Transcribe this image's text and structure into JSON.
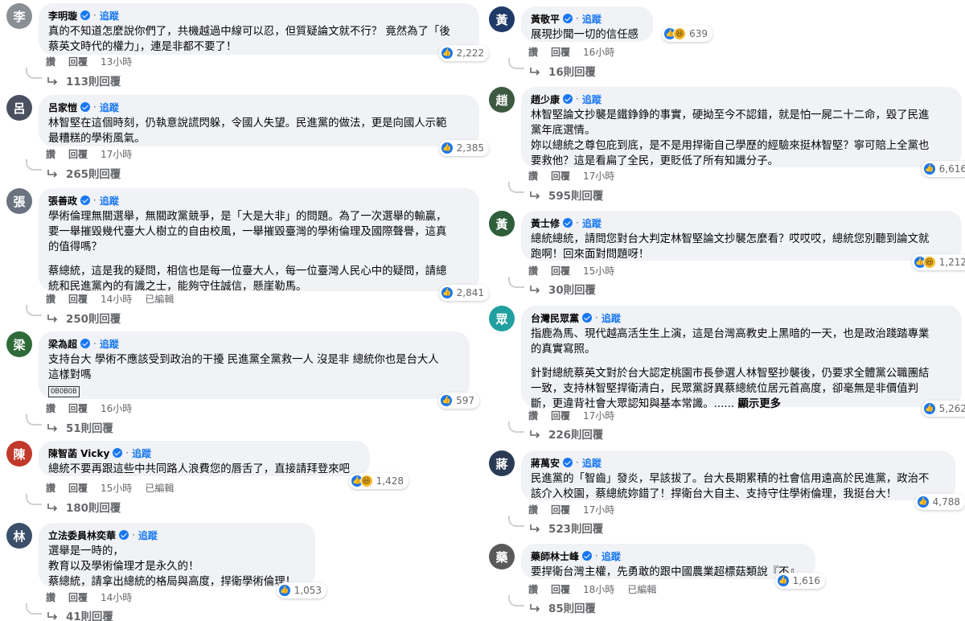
{
  "ui": {
    "follow": "追蹤",
    "read": "讚",
    "reply": "回覆",
    "edited": "已編輯",
    "see_more": "顯示更多"
  },
  "left": [
    {
      "name": "李明璇",
      "avatar": "李",
      "avatar_color": "#8a8f96",
      "lines": [
        "真的不知道怎麼說你們了，共機越過中線可以忍，但質疑論文就不行？ 竟然為了「後",
        "蔡英文時代的權力」，連是非都不要了！"
      ],
      "time": "13小時",
      "reactions": "2,222",
      "replies": "113則回覆"
    },
    {
      "name": "呂家愷",
      "avatar": "呂",
      "avatar_color": "#4a5060",
      "lines": [
        "林智堅在這個時刻，仍執意說謊閃躲，令國人失望。民進黨的做法，更是向國人示範",
        "最糟糕的學術風氣。"
      ],
      "time": "17小時",
      "reactions": "2,385",
      "replies": "265則回覆"
    },
    {
      "name": "張善政",
      "avatar": "張",
      "avatar_color": "#6b7280",
      "lines": [
        "學術倫理無關選舉，無關政黨競爭，是「大是大非」的問題。為了一次選舉的輸贏，",
        "要一舉摧毀幾代臺大人樹立的自由校風，一舉摧毀臺灣的學術倫理及國際聲譽，這真",
        "的值得嗎？"
      ],
      "lines2": [
        "蔡總統，這是我的疑問，相信也是每一位臺大人，每一位臺灣人民心中的疑問，請總",
        "統和民進黨內的有識之士，能夠守住誠信，懸崖勒馬。"
      ],
      "time": "14小時",
      "edited": true,
      "reactions": "2,841",
      "replies": "250則回覆"
    },
    {
      "name": "梁為超",
      "avatar": "梁",
      "avatar_color": "#2f6b3a",
      "lines": [
        "支持台大 學術不應該受到政治的干擾 民進黨全黨救一人 沒是非 總統你也是台大人",
        "這樣對嗎"
      ],
      "badge": "OBOBOB",
      "time": "16小時",
      "reactions": "597",
      "replies": "51則回覆"
    },
    {
      "name": "陳智菡 Vicky",
      "avatar": "陳",
      "avatar_color": "#c0392b",
      "lines": [
        "總統不要再跟這些中共同路人浪費您的唇舌了，直接請拜登來吧"
      ],
      "time": "15小時",
      "edited": true,
      "reactions": "1,428",
      "replies": "180則回覆"
    },
    {
      "name": "立法委員林奕華",
      "avatar": "林",
      "avatar_color": "#3b4f6b",
      "lines": [
        "選舉是一時的，",
        "教育以及學術倫理才是永久的！",
        "蔡總統，請拿出總統的格局與高度，捍衛學術倫理！"
      ],
      "time": "14小時",
      "reactions": "1,053",
      "replies": "41則回覆"
    }
  ],
  "right": [
    {
      "name": "黃敬平",
      "avatar": "黃",
      "avatar_color": "#1f3a68",
      "lines": [
        "展現抄聞一切的信任感"
      ],
      "time": "16小時",
      "reactions": "639",
      "replies": "16則回覆"
    },
    {
      "name": "趙少康",
      "avatar": "趙",
      "avatar_color": "#3d5a40",
      "lines": [
        "林智堅論文抄襲是鐵錚錚的事實，硬拗至今不認錯，就是怕一屍二十二命，毀了民進",
        "黨年底選情。",
        "妳以總統之尊包庇到底，是不是用捍衛自己學歷的經驗來挺林智堅？寧可賠上全黨也",
        "要救他？這是看扁了全民，更貶低了所有知識分子。"
      ],
      "time": "17小時",
      "reactions": "6,616",
      "replies": "595則回覆"
    },
    {
      "name": "黃士修",
      "avatar": "黃",
      "avatar_color": "#2e5e3a",
      "lines": [
        "總統總統，請問您對台大判定林智堅論文抄襲怎麼看？哎哎哎，總統您別聽到論文就",
        "跑啊！回來面對問題呀！"
      ],
      "time": "15小時",
      "reactions": "1,212",
      "replies": "30則回覆"
    },
    {
      "name": "台灣民眾黨",
      "avatar": "眾",
      "avatar_color": "#21a0a0",
      "lines": [
        "指鹿為馬、現代越高活生生上演，這是台灣高教史上黑暗的一天，也是政治踐踏專業",
        "的真實寫照。"
      ],
      "lines2": [
        "針對總統蔡英文對於台大認定桃園市長參選人林智堅抄襲後，仍要求全體黨公職團結",
        "一致，支持林智堅捍衛清白，民眾黨訝異蔡總統位居元首高度，卻毫無是非價值判",
        "斷，更違背社會大眾認知與基本常識。......"
      ],
      "time": "17小時",
      "reactions": "5,262",
      "replies": "226則回覆"
    },
    {
      "name": "蔣萬安",
      "avatar": "蔣",
      "avatar_color": "#2b3a55",
      "lines": [
        "民進黨的「智齒」發炎，早該拔了。台大長期累積的社會信用遠高於民進黨，政治不",
        "該介入校園，蔡總統妳錯了！捍衛台大自主、支持守住學術倫理，我挺台大！"
      ],
      "time": "17小時",
      "reactions": "4,788",
      "replies": "523則回覆"
    },
    {
      "name": "藥師林士峰",
      "avatar": "藥",
      "avatar_color": "#5a5a5a",
      "lines": [
        "要捍衛台灣主權，先勇敢的跟中國農業超標菇類說『不』"
      ],
      "time": "18小時",
      "edited": true,
      "reactions": "1,616",
      "replies": "85則回覆"
    }
  ]
}
